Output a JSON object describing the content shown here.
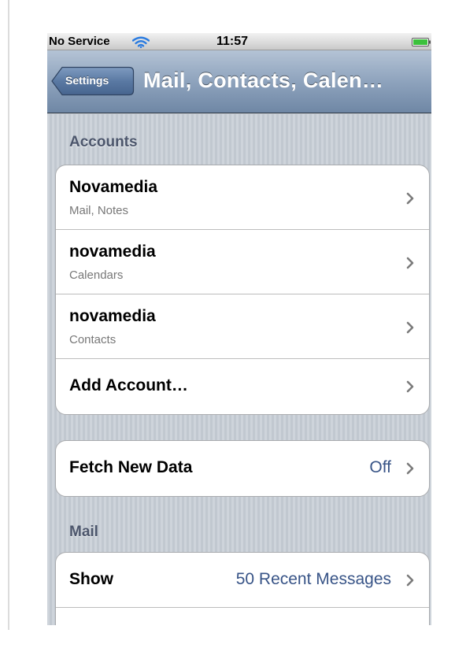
{
  "status_bar": {
    "carrier": "No Service",
    "time": "11:57",
    "wifi_icon": "wifi-icon",
    "battery_icon": "battery-icon",
    "battery_color": "#3cc13c"
  },
  "nav_bar": {
    "back_label": "Settings",
    "title": "Mail, Contacts, Calen…"
  },
  "accounts": {
    "header": "Accounts",
    "rows": [
      {
        "title": "Novamedia",
        "subtitle": "Mail, Notes"
      },
      {
        "title": "novamedia",
        "subtitle": "Calendars"
      },
      {
        "title": "novamedia",
        "subtitle": "Contacts"
      },
      {
        "title": "Add Account…"
      }
    ]
  },
  "fetch": {
    "title": "Fetch New Data",
    "value": "Off"
  },
  "mail": {
    "header": "Mail",
    "rows": [
      {
        "title": "Show",
        "value": "50 Recent Messages"
      }
    ]
  },
  "colors": {
    "value_text": "#385487",
    "section_header": "#4c566c",
    "nav_bar": "#7f96b3"
  }
}
